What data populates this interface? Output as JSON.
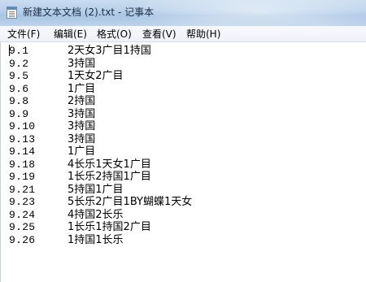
{
  "window": {
    "title": "新建文本文档 (2).txt - 记事本",
    "icon": "notepad-icon"
  },
  "menu": {
    "items": [
      {
        "label": "文件(F)"
      },
      {
        "label": "编辑(E)"
      },
      {
        "label": "格式(O)"
      },
      {
        "label": "查看(V)"
      },
      {
        "label": "帮助(H)"
      }
    ]
  },
  "editor": {
    "lines": [
      {
        "date": "9.1",
        "text": "2天女3广目1持国"
      },
      {
        "date": "9.2",
        "text": "3持国"
      },
      {
        "date": "9.5",
        "text": "1天女2广目"
      },
      {
        "date": "9.6",
        "text": "1广目"
      },
      {
        "date": "9.8",
        "text": "2持国"
      },
      {
        "date": "9.9",
        "text": "3持国"
      },
      {
        "date": "9.10",
        "text": "3持国"
      },
      {
        "date": "9.13",
        "text": "3持国"
      },
      {
        "date": "9.14",
        "text": "1广目"
      },
      {
        "date": "9.18",
        "text": "4长乐1天女1广目"
      },
      {
        "date": "9.19",
        "text": "1长乐2持国1广目"
      },
      {
        "date": "9.21",
        "text": "5持国1广目"
      },
      {
        "date": "9.23",
        "text": "5长乐2广目1BY蝴蝶1天女"
      },
      {
        "date": "9.24",
        "text": "4持国2长乐"
      },
      {
        "date": "9.25",
        "text": "1长乐1持国2广目"
      },
      {
        "date": "9.26",
        "text": "1持国1长乐"
      }
    ]
  }
}
